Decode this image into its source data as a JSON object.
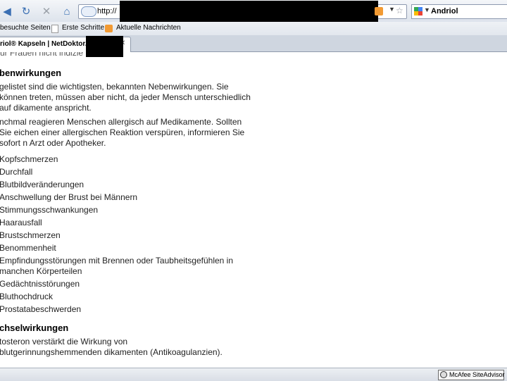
{
  "toolbar": {
    "back_icon": "back-arrow-icon",
    "reload_icon": "reload-icon",
    "stop_icon": "stop-icon",
    "home_icon": "home-icon",
    "url_text": "http://",
    "search_value": "Andriol"
  },
  "bookmarks": {
    "items": [
      "besuchte Seiten",
      "Erste Schritte",
      "Aktuelle Nachrichten"
    ]
  },
  "tab": {
    "title": "riol® Kapseln | NetDoktor.d"
  },
  "page": {
    "cut_text": "ür Frauen nicht indizie",
    "side_effects": {
      "heading": "benwirkungen",
      "para1": "gelistet sind die wichtigsten, bekannten Nebenwirkungen. Sie können treten, müssen aber nicht, da jeder Mensch unterschiedlich auf dikamente anspricht.",
      "para2": "nchmal reagieren Menschen allergisch auf Medikamente. Sollten Sie eichen einer allergischen Reaktion verspüren, informieren Sie sofort n Arzt oder Apotheker.",
      "list": [
        "Kopfschmerzen",
        "Durchfall",
        "Blutbildveränderungen",
        "Anschwellung der Brust bei Männern",
        "Stimmungsschwankungen",
        "Haarausfall",
        "Brustschmerzen",
        "Benommenheit",
        "Empfindungsstörungen mit Brennen oder Taubheitsgefühlen in manchen Körperteilen",
        "Gedächtnisstörungen",
        "Bluthochdruck",
        "Prostatabeschwerden"
      ]
    },
    "interactions": {
      "heading": "chselwirkungen",
      "para": "tosteron verstärkt die Wirkung von blutgerinnungshemmenden dikamenten (Antikoagulanzien)."
    }
  },
  "status": {
    "mcafee": "McAfee SiteAdvisor"
  },
  "colors": {
    "accent": "#3a6fb3",
    "rss": "#f29a33"
  }
}
